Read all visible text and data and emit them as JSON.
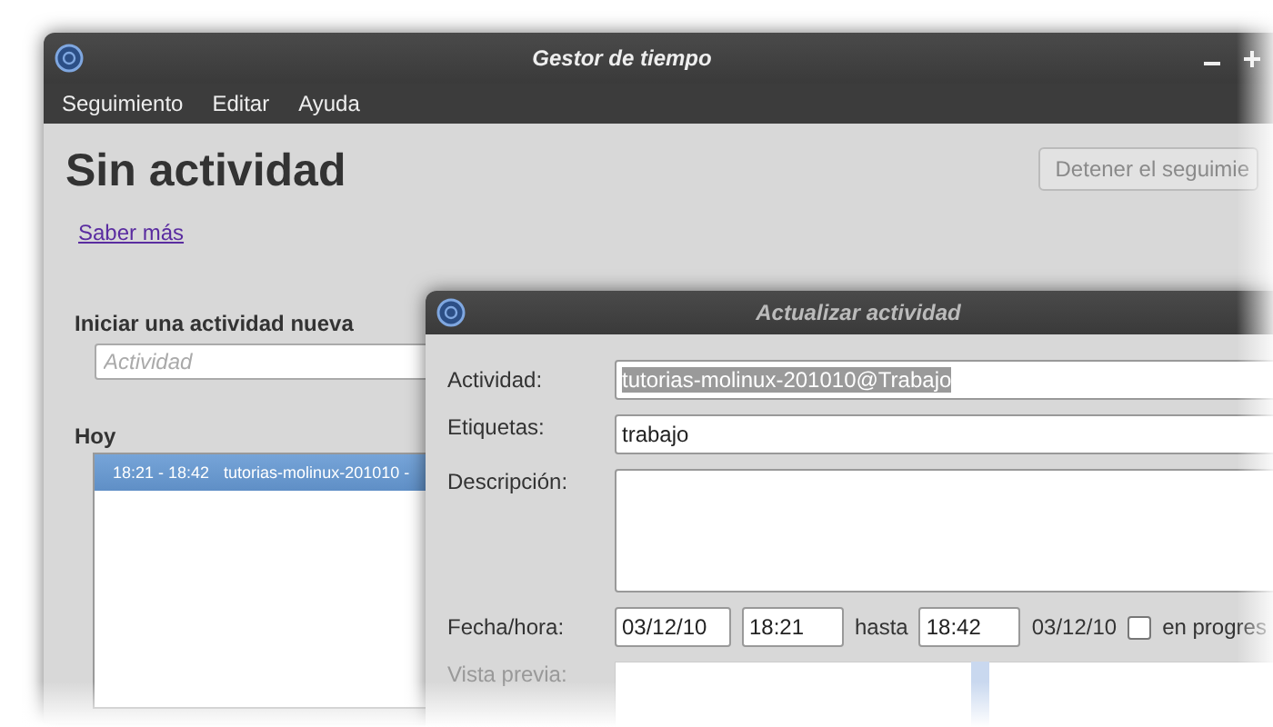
{
  "main_window": {
    "title": "Gestor de tiempo",
    "menu": [
      {
        "label": "Seguimiento"
      },
      {
        "label": "Editar"
      },
      {
        "label": "Ayuda"
      }
    ],
    "status": "Sin actividad",
    "stop_button": {
      "label": "Detener el seguimie",
      "disabled": true
    },
    "link": "Saber más",
    "new_activity": {
      "heading": "Iniciar una actividad nueva",
      "placeholder": "Actividad"
    },
    "today": {
      "heading": "Hoy",
      "rows": [
        {
          "time": "18:21 - 18:42",
          "activity": "tutorias-molinux-201010 -",
          "selected": true
        }
      ]
    }
  },
  "dialog": {
    "title": "Actualizar actividad",
    "activity": {
      "label": "Actividad:",
      "value": "tutorias-molinux-201010@Trabajo",
      "text_selected": true
    },
    "tags": {
      "label": "Etiquetas:",
      "value": "trabajo"
    },
    "description": {
      "label": "Descripción:"
    },
    "datetime": {
      "label": "Fecha/hora:",
      "date": "03/12/10",
      "start": "18:21",
      "until": "hasta",
      "end": "18:42",
      "end_date": "03/12/10",
      "in_progress": {
        "label": "en progres",
        "checked": false
      }
    },
    "preview": {
      "label": "Vista previa:",
      "disabled": true
    }
  }
}
